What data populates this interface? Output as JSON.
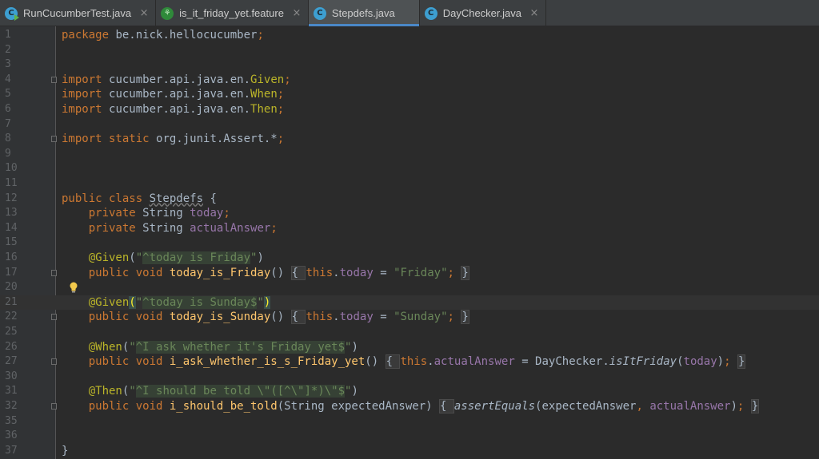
{
  "tabs": [
    {
      "label": "RunCucumberTest.java",
      "icon": "java-test-class-icon",
      "active": false
    },
    {
      "label": "is_it_friday_yet.feature",
      "icon": "cucumber-feature-icon",
      "active": false
    },
    {
      "label": "Stepdefs.java",
      "icon": "java-class-icon",
      "active": true
    },
    {
      "label": "DayChecker.java",
      "icon": "java-class-icon",
      "active": false
    }
  ],
  "lines": [
    {
      "n": "1",
      "t": [
        {
          "s": "package ",
          "c": "kw"
        },
        {
          "s": "be.nick.hellocucumber"
        },
        {
          "s": ";",
          "c": "kw"
        }
      ]
    },
    {
      "n": "2",
      "t": []
    },
    {
      "n": "3",
      "t": []
    },
    {
      "n": "4",
      "fold": true,
      "t": [
        {
          "s": "import ",
          "c": "kw"
        },
        {
          "s": "cucumber.api.java.en."
        },
        {
          "s": "Given",
          "c": "ann"
        },
        {
          "s": ";",
          "c": "kw"
        }
      ]
    },
    {
      "n": "5",
      "t": [
        {
          "s": "import ",
          "c": "kw"
        },
        {
          "s": "cucumber.api.java.en."
        },
        {
          "s": "When",
          "c": "ann"
        },
        {
          "s": ";",
          "c": "kw"
        }
      ]
    },
    {
      "n": "6",
      "t": [
        {
          "s": "import ",
          "c": "kw"
        },
        {
          "s": "cucumber.api.java.en."
        },
        {
          "s": "Then",
          "c": "ann"
        },
        {
          "s": ";",
          "c": "kw"
        }
      ]
    },
    {
      "n": "7",
      "t": []
    },
    {
      "n": "8",
      "fold": true,
      "t": [
        {
          "s": "import static ",
          "c": "kw"
        },
        {
          "s": "org.junit.Assert.*"
        },
        {
          "s": ";",
          "c": "kw"
        }
      ]
    },
    {
      "n": "9",
      "t": []
    },
    {
      "n": "10",
      "t": []
    },
    {
      "n": "11",
      "t": []
    },
    {
      "n": "12",
      "t": [
        {
          "s": "public class ",
          "c": "kw"
        },
        {
          "s": "Stepdefs",
          "c": "sq"
        },
        {
          "s": " {"
        }
      ]
    },
    {
      "n": "13",
      "t": [
        {
          "s": "    private ",
          "c": "kw"
        },
        {
          "s": "String "
        },
        {
          "s": "today",
          "c": "fld"
        },
        {
          "s": ";",
          "c": "kw"
        }
      ]
    },
    {
      "n": "14",
      "t": [
        {
          "s": "    private ",
          "c": "kw"
        },
        {
          "s": "String "
        },
        {
          "s": "actualAnswer",
          "c": "fld"
        },
        {
          "s": ";",
          "c": "kw"
        }
      ]
    },
    {
      "n": "15",
      "t": []
    },
    {
      "n": "16",
      "t": [
        {
          "s": "    "
        },
        {
          "s": "@Given",
          "c": "ann"
        },
        {
          "s": "("
        },
        {
          "s": "\"",
          "c": "str"
        },
        {
          "s": "^today is Friday",
          "c": "str re"
        },
        {
          "s": "\"",
          "c": "str"
        },
        {
          "s": ")"
        }
      ]
    },
    {
      "n": "17",
      "fold": true,
      "t": [
        {
          "s": "    public void ",
          "c": "kw"
        },
        {
          "s": "today_is_Friday",
          "c": "fn"
        },
        {
          "s": "() "
        },
        {
          "s": "{ ",
          "c": "fd"
        },
        {
          "s": "this",
          "c": "kw"
        },
        {
          "s": "."
        },
        {
          "s": "today",
          "c": "fld"
        },
        {
          "s": " = "
        },
        {
          "s": "\"Friday\"",
          "c": "str"
        },
        {
          "s": "; ",
          "c": "kw"
        },
        {
          "s": "}",
          "c": "fd"
        }
      ]
    },
    {
      "n": "20",
      "bulb": true,
      "t": []
    },
    {
      "n": "21",
      "current": true,
      "t": [
        {
          "s": "    "
        },
        {
          "s": "@Given",
          "c": "ann"
        },
        {
          "s": "(",
          "c": "brc"
        },
        {
          "s": "\"",
          "c": "str"
        },
        {
          "s": "^today is Sunday$",
          "c": "str re"
        },
        {
          "s": "\"",
          "c": "str"
        },
        {
          "s": ")",
          "c": "brc"
        }
      ]
    },
    {
      "n": "22",
      "fold": true,
      "t": [
        {
          "s": "    public void ",
          "c": "kw"
        },
        {
          "s": "today_is_Sunday",
          "c": "fn"
        },
        {
          "s": "() "
        },
        {
          "s": "{ ",
          "c": "fd"
        },
        {
          "s": "this",
          "c": "kw"
        },
        {
          "s": "."
        },
        {
          "s": "today",
          "c": "fld"
        },
        {
          "s": " = "
        },
        {
          "s": "\"Sunday\"",
          "c": "str"
        },
        {
          "s": "; ",
          "c": "kw"
        },
        {
          "s": "}",
          "c": "fd"
        }
      ]
    },
    {
      "n": "25",
      "t": []
    },
    {
      "n": "26",
      "t": [
        {
          "s": "    "
        },
        {
          "s": "@When",
          "c": "ann"
        },
        {
          "s": "("
        },
        {
          "s": "\"",
          "c": "str"
        },
        {
          "s": "^I ask whether it's Friday yet$",
          "c": "str re"
        },
        {
          "s": "\"",
          "c": "str"
        },
        {
          "s": ")"
        }
      ]
    },
    {
      "n": "27",
      "fold": true,
      "t": [
        {
          "s": "    public void ",
          "c": "kw"
        },
        {
          "s": "i_ask_whether_is_s_Friday_yet",
          "c": "fn"
        },
        {
          "s": "() "
        },
        {
          "s": "{ ",
          "c": "fd"
        },
        {
          "s": "this",
          "c": "kw"
        },
        {
          "s": "."
        },
        {
          "s": "actualAnswer",
          "c": "fld"
        },
        {
          "s": " = DayChecker."
        },
        {
          "s": "isItFriday",
          "c": "it"
        },
        {
          "s": "("
        },
        {
          "s": "today",
          "c": "fld"
        },
        {
          "s": ")"
        },
        {
          "s": "; ",
          "c": "kw"
        },
        {
          "s": "}",
          "c": "fd"
        }
      ]
    },
    {
      "n": "30",
      "t": []
    },
    {
      "n": "31",
      "t": [
        {
          "s": "    "
        },
        {
          "s": "@Then",
          "c": "ann"
        },
        {
          "s": "("
        },
        {
          "s": "\"",
          "c": "str"
        },
        {
          "s": "^I should be told \\\"([^\\\"]*)\\\"$",
          "c": "str re"
        },
        {
          "s": "\"",
          "c": "str"
        },
        {
          "s": ")"
        }
      ]
    },
    {
      "n": "32",
      "fold": true,
      "t": [
        {
          "s": "    public void ",
          "c": "kw"
        },
        {
          "s": "i_should_be_told",
          "c": "fn"
        },
        {
          "s": "(String expectedAnswer) "
        },
        {
          "s": "{ ",
          "c": "fd"
        },
        {
          "s": "assertEquals",
          "c": "it"
        },
        {
          "s": "(expectedAnswer"
        },
        {
          "s": ", ",
          "c": "kw"
        },
        {
          "s": "actualAnswer",
          "c": "fld"
        },
        {
          "s": ")"
        },
        {
          "s": "; ",
          "c": "kw"
        },
        {
          "s": "}",
          "c": "fd"
        }
      ]
    },
    {
      "n": "35",
      "t": []
    },
    {
      "n": "36",
      "t": []
    },
    {
      "n": "37",
      "t": [
        {
          "s": "}"
        }
      ]
    }
  ]
}
